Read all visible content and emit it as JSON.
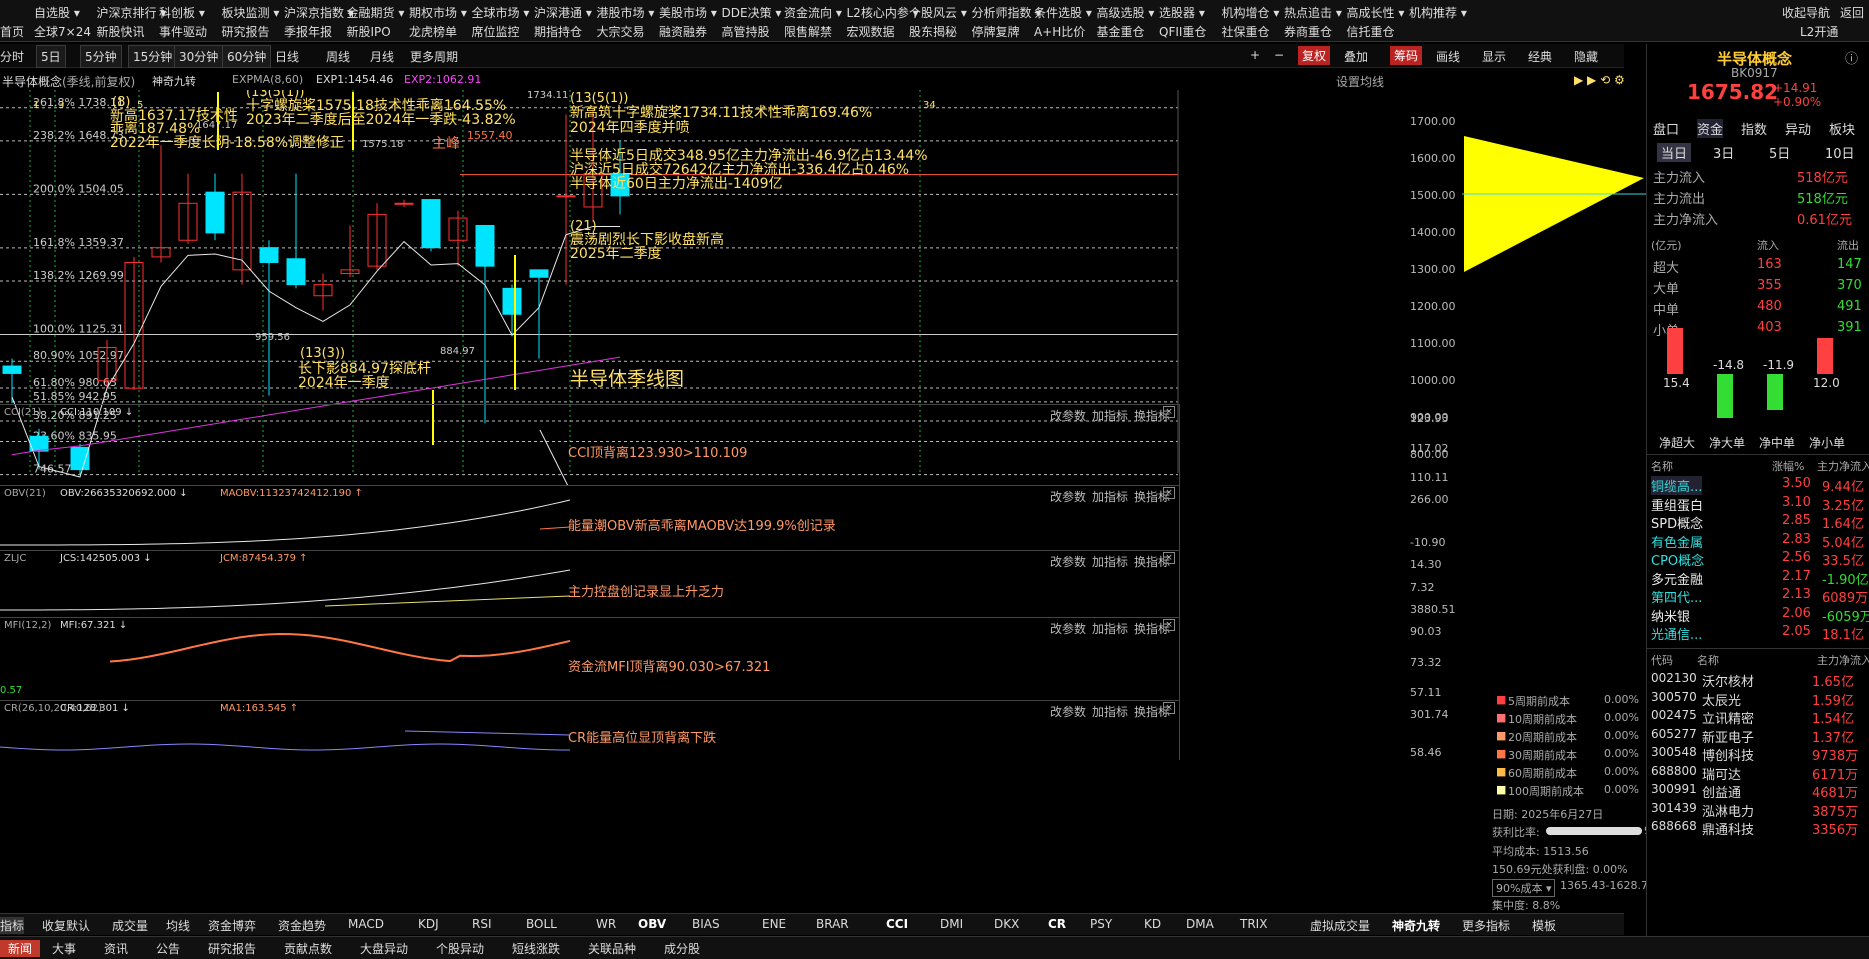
{
  "nav": {
    "row1": [
      "自选股",
      "沪深京排行",
      "科创板",
      "板块监测",
      "沪深京指数",
      "金融期货",
      "期权市场",
      "全球市场",
      "沪深港通",
      "港股市场",
      "美股市场",
      "DDE决策",
      "资金流向",
      "L2核心内参",
      "个股风云",
      "分析师指数",
      "条件选股",
      "高级选股",
      "选股器",
      "机构增仓",
      "热点追击",
      "高成长性",
      "机构推荐",
      "收起导航",
      "返回"
    ],
    "row2": [
      "全球7×24",
      "新股快讯",
      "事件驱动",
      "研究报告",
      "季报年报",
      "新股IPO",
      "龙虎榜单",
      "席位监控",
      "期指持仓",
      "大宗交易",
      "融资融券",
      "高管持股",
      "限售解禁",
      "宏观数据",
      "股东揭秘",
      "停牌复牌",
      "A+H比价",
      "基金重仓",
      "QFII重仓",
      "社保重仓",
      "券商重仓",
      "信托重仓",
      "L2开通"
    ],
    "row1_prefix": "",
    "row2_prefix": "首页"
  },
  "toolbar": {
    "items": [
      "分时",
      "5日",
      "5分钟",
      "15分钟",
      "30分钟",
      "60分钟",
      "日线",
      "周线",
      "月线",
      "更多周期"
    ],
    "right": [
      "复权",
      "叠加",
      "筹码",
      "画线",
      "显示",
      "经典",
      "隐藏"
    ]
  },
  "header": {
    "title": "半导体概念",
    "sub": "(季线,前复权)",
    "ind": "神奇九转",
    "expma": "EXPMA(8,60)",
    "exp1": "EXP1:1454.46",
    "exp2": "EXP2:1062.91",
    "setting": "设置均线"
  },
  "chart_data": [
    {
      "type": "candlestick",
      "title": "半导体季线图",
      "y_ticks": [
        "1700.00",
        "1600.00",
        "1500.00",
        "1400.00",
        "1300.00",
        "1200.00",
        "1100.00",
        "1000.00",
        "900.00",
        "800.00"
      ],
      "ylim": [
        740,
        1770
      ],
      "candles": [
        [
          1040,
          1020,
          1060,
          940
        ],
        [
          850,
          810,
          870,
          760
        ],
        [
          820,
          760,
          830,
          746
        ],
        [
          1000,
          1090,
          1110,
          980
        ],
        [
          980,
          1320,
          1335,
          975
        ],
        [
          1335,
          1360,
          1637,
          1320
        ],
        [
          1380,
          1480,
          1560,
          1370
        ],
        [
          1510,
          1400,
          1560,
          1380
        ],
        [
          1300,
          1510,
          1560,
          1260
        ],
        [
          1360,
          1320,
          1380,
          960
        ],
        [
          1330,
          1260,
          1560,
          1250
        ],
        [
          1230,
          1260,
          1290,
          1190
        ],
        [
          1290,
          1300,
          1420,
          1280
        ],
        [
          1310,
          1450,
          1480,
          1300
        ],
        [
          1480,
          1480,
          1490,
          1470
        ],
        [
          1490,
          1360,
          1490,
          1350
        ],
        [
          1380,
          1440,
          1460,
          1310
        ],
        [
          1420,
          1310,
          1420,
          884.97
        ],
        [
          1250,
          1180,
          1260,
          1120
        ],
        [
          1300,
          1280,
          1300,
          1060
        ],
        [
          1500,
          1500,
          1720,
          1260
        ],
        [
          1470,
          1560,
          1734.11,
          1430
        ],
        [
          1560,
          1500,
          1650,
          1450
        ]
      ],
      "fib_levels": [
        "261.8% 1738.11",
        "238.2% 1648.73",
        "200.0% 1504.05",
        "161.8% 1359.37",
        "138.2% 1269.99",
        "100.0% 1125.31",
        "80.90% 1052.97",
        "61.80% 980.63",
        "51.85% 942.95",
        "38.20% 891.25",
        "23.60% 835.95",
        "746.57"
      ],
      "annotations": [
        "(8)",
        "新高1637.17技术性",
        "乖离187.48%",
        "2022年一季度长阴-18.58%调整修正",
        "(13(5(1))",
        "十字螺旋桨1575.18技术性乖离164.55%",
        "2023年二季度后至2024年一季跌-43.82%",
        "(13(5(1))",
        "新高筑十字螺旋桨1734.11技术性乖离169.46%",
        "2024年四季度并喷",
        "主峰",
        "1557.40",
        "半导体近5日成交348.95亿主力净流出-46.9亿占13.44%",
        "沪深近5日成交72642亿主力净流出-336.4亿占0.46%",
        "半导体近60日主力净流出-1409亿",
        "(21)",
        "震荡剧烈长下影收盘新高",
        "2025年二季度",
        "(13(3))",
        "长下影884.97探底杆",
        "2024年一季度",
        "1575.18",
        "959.56",
        "884.97",
        "1734.11",
        "1647.17",
        "34",
        "3",
        "1",
        "5"
      ]
    },
    {
      "type": "line",
      "title": "CCI(21)",
      "value": "CCI:110.109",
      "y_ticks": [
        "123.93",
        "117.02",
        "110.11"
      ],
      "note": "CCI顶背离123.930>110.109"
    },
    {
      "type": "line",
      "title": "OBV(21)",
      "value": "OBV:26635320692.000",
      "ma": "MAOBV:11323742412.190",
      "y_ticks": [
        "266.00",
        "-10.90"
      ],
      "note": "能量潮OBV新高乖离MAOBV达199.9%创记录"
    },
    {
      "type": "line",
      "title": "ZLJC",
      "value": "JCS:142505.003",
      "ma": "JCM:87454.379",
      "y_ticks": [
        "14.30",
        "7.32",
        "3880.51"
      ],
      "note": "主力控盘创记录显上升乏力"
    },
    {
      "type": "line",
      "title": "MFI(12,2)",
      "value": "MFI:67.321",
      "y_ticks": [
        "90.03",
        "73.32",
        "57.11"
      ],
      "left_val": "0.57",
      "note": "资金流MFI顶背离90.030>67.321"
    },
    {
      "type": "line",
      "title": "CR(26,10,20,40,62)",
      "value": "CR:128.301",
      "ma": "MA1:163.545",
      "y_ticks": [
        "301.74",
        "58.46"
      ],
      "note": "CR能量高位显顶背离下跌"
    }
  ],
  "panel_buttons": [
    "改参数",
    "加指标",
    "换指标"
  ],
  "cost": {
    "rows": [
      [
        "5周期前成本",
        "0.00%"
      ],
      [
        "10周期前成本",
        "0.00%"
      ],
      [
        "20周期前成本",
        "0.00%"
      ],
      [
        "30周期前成本",
        "0.00%"
      ],
      [
        "60周期前成本",
        "0.00%"
      ],
      [
        "100周期前成本",
        "0.00%"
      ]
    ],
    "date": "日期: 2025年6月27日",
    "profit_label": "获利比率:",
    "profit": "99.95%",
    "avg": "平均成本: 1513.56",
    "note": "150.69元处获利盘: 0.00%",
    "range_label": "90%成本",
    "range": "1365.43-1628.77",
    "conc": "集中度: 8.8%"
  },
  "bottom_tabs": [
    "指标",
    "收复默认",
    "成交量",
    "均线",
    "资金博弈",
    "资金趋势",
    "MACD",
    "KDJ",
    "RSI",
    "BOLL",
    "WR",
    "OBV",
    "BIAS",
    "ENE",
    "BRAR",
    "CCI",
    "DMI",
    "DKX",
    "CR",
    "PSY",
    "KD",
    "DMA",
    "TRIX",
    "虚拟成交量",
    "神奇九转",
    "更多指标",
    "模板"
  ],
  "bottom_bar": [
    "新闻",
    "大事",
    "资讯",
    "公告",
    "研究报告",
    "贡献点数",
    "大盘异动",
    "个股异动",
    "短线涨跌",
    "关联品种",
    "成分股"
  ],
  "right": {
    "name": "半导体概念",
    "code": "BK0917",
    "price": "1675.82",
    "chg": "+14.91",
    "pct": "+0.90%",
    "tabs": [
      "盘口",
      "资金",
      "指数",
      "异动",
      "板块"
    ],
    "periods": [
      "当日",
      "3日",
      "5日",
      "10日"
    ],
    "flow": [
      [
        "主力流入",
        "518亿元"
      ],
      [
        "主力流出",
        "518亿元"
      ],
      [
        "主力净流入",
        "0.61亿元"
      ]
    ],
    "unit": "(亿元)",
    "in": "流入",
    "out": "流出",
    "orders": [
      [
        "超大",
        "163",
        "147"
      ],
      [
        "大单",
        "355",
        "370"
      ],
      [
        "中单",
        "480",
        "491"
      ],
      [
        "小单",
        "403",
        "391"
      ]
    ],
    "net": {
      "values": [
        15.4,
        -14.8,
        -11.9,
        12.0
      ],
      "labels": [
        "15.4",
        "-14.8",
        "-11.9",
        "12.0"
      ],
      "names": [
        "净超大",
        "净大单",
        "净中单",
        "净小单"
      ]
    },
    "sector_head": [
      "名称",
      "涨幅%",
      "主力净流入"
    ],
    "sectors": [
      [
        "铜缆高...",
        "3.50",
        "9.44亿"
      ],
      [
        "重组蛋白",
        "3.10",
        "3.25亿"
      ],
      [
        "SPD概念",
        "2.85",
        "1.64亿"
      ],
      [
        "有色金属",
        "2.83",
        "5.04亿"
      ],
      [
        "CPO概念",
        "2.56",
        "33.5亿"
      ],
      [
        "多元金融",
        "2.17",
        "-1.90亿"
      ],
      [
        "第四代...",
        "2.13",
        "6089万"
      ],
      [
        "纳米银",
        "2.06",
        "-6059万"
      ],
      [
        "光通信...",
        "2.05",
        "18.1亿"
      ]
    ],
    "stock_head": [
      "代码",
      "名称",
      "主力净流入"
    ],
    "stocks": [
      [
        "002130",
        "沃尔核材",
        "1.65亿"
      ],
      [
        "300570",
        "太辰光",
        "1.59亿"
      ],
      [
        "002475",
        "立讯精密",
        "1.54亿"
      ],
      [
        "605277",
        "新亚电子",
        "1.37亿"
      ],
      [
        "300548",
        "博创科技",
        "9738万"
      ],
      [
        "688800",
        "瑞可达",
        "6171万"
      ],
      [
        "300991",
        "创益通",
        "4681万"
      ],
      [
        "301439",
        "泓淋电力",
        "3875万"
      ],
      [
        "688668",
        "鼎通科技",
        "3356万"
      ]
    ]
  }
}
